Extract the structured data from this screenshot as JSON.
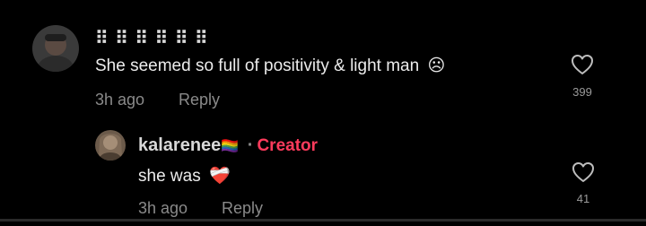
{
  "comments": [
    {
      "username": "⠿ ⠿ ⠿ ⠿ ⠿ ⠿",
      "text": "She seemed so full of positivity & light man",
      "emoji": "☹",
      "time": "3h ago",
      "reply_label": "Reply",
      "likes": "399"
    },
    {
      "username": "kalarenee",
      "username_emoji": "🏳️‍🌈",
      "separator": "·",
      "badge": "Creator",
      "text": "she was",
      "emoji": "❤️‍🩹",
      "time": "3h ago",
      "reply_label": "Reply",
      "likes": "41"
    }
  ],
  "colors": {
    "background": "#000000",
    "creator_badge": "#ff3b5c",
    "meta": "#8a8a8a"
  },
  "icons": {
    "like": "heart-outline-icon"
  }
}
